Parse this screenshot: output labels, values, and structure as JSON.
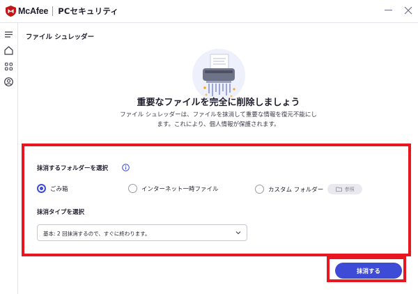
{
  "window": {
    "brand": "McAfee",
    "product": "PCセキュリティ"
  },
  "page": {
    "title": "ファイル シュレッダー",
    "headline": "重要なファイルを完全に削除しましょう",
    "description_line1": "ファイル シュレッダーは、ファイルを抹消して重要な情報を復元不能にし",
    "description_line2": "ます。これにより、個人情報が保護されます。"
  },
  "folder_section": {
    "label": "抹消するフォルダーを選択",
    "options": [
      {
        "label": "ごみ箱",
        "checked": true
      },
      {
        "label": "インターネット一時ファイル",
        "checked": false
      },
      {
        "label": "カスタム フォルダー",
        "checked": false
      }
    ],
    "browse_label": "参照"
  },
  "type_section": {
    "label": "抹消タイプを選択",
    "selected": "基本: 2 回抹消するので、すぐに終わります。"
  },
  "action": {
    "shred_label": "抹消する"
  },
  "colors": {
    "brand_red": "#c01818",
    "accent": "#3d4bd6",
    "highlight": "#e8161f"
  },
  "icons": {
    "sidebar": [
      "menu-icon",
      "home-icon",
      "apps-grid-icon",
      "account-icon"
    ]
  }
}
